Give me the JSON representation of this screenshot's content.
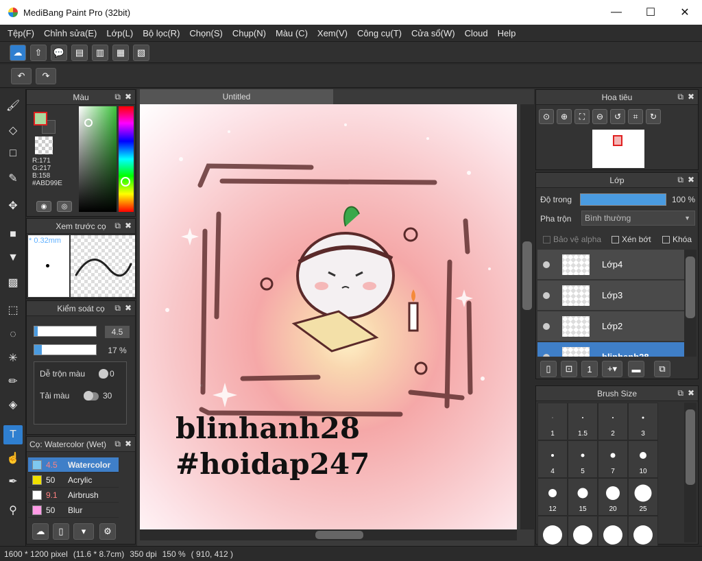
{
  "window": {
    "title": "MediBang Paint Pro (32bit)",
    "minimize": "—",
    "maximize": "☐",
    "close": "✕"
  },
  "menu": [
    "Tệp(F)",
    "Chỉnh sửa(E)",
    "Lớp(L)",
    "Bộ lọc(R)",
    "Chọn(S)",
    "Chụp(N)",
    "Màu (C)",
    "Xem(V)",
    "Công cụ(T)",
    "Cửa sổ(W)",
    "Cloud",
    "Help"
  ],
  "color_panel": {
    "title": "Màu",
    "r": "R:171",
    "g": "G:217",
    "b": "B:158",
    "hex": "#ABD99E",
    "current_color": "#ABD99E"
  },
  "brush_preview": {
    "title": "Xem trước cọ",
    "size": "* 0.32mm"
  },
  "brush_control": {
    "title": "Kiểm soát cọ",
    "size_value": "4.5",
    "size_fill": 0.05,
    "opacity_value": "17 %",
    "opacity_fill": 0.12,
    "blend_label": "Dễ trộn màu",
    "blend_value": "0",
    "load_label": "Tải màu",
    "load_value": "30"
  },
  "brush_list": {
    "title": "Cọ: Watercolor (Wet)",
    "items": [
      {
        "num": "4.5",
        "name": "Watercolor",
        "color": "#7ec8f0"
      },
      {
        "num": "50",
        "name": "Acrylic",
        "color": "#f0e000"
      },
      {
        "num": "9.1",
        "name": "Airbrush",
        "color": "#ffffff"
      },
      {
        "num": "50",
        "name": "Blur",
        "color": "#ff9be6"
      }
    ]
  },
  "document": {
    "tab": "Untitled",
    "text1": "blinhanh28",
    "text2": "#hoidap247"
  },
  "navigator": {
    "title": "Hoa tiêu"
  },
  "layers": {
    "title": "Lớp",
    "opacity_label": "Độ trong",
    "opacity_value": "100 %",
    "blend_label": "Pha trộn",
    "blend_value": "Bình thường",
    "protect_alpha": "Bảo vệ alpha",
    "clip": "Xén bớt",
    "lock": "Khóa",
    "items": [
      {
        "name": "Lớp4"
      },
      {
        "name": "Lớp3"
      },
      {
        "name": "Lớp2"
      },
      {
        "name": "blinhanh28"
      }
    ]
  },
  "brush_size": {
    "title": "Brush Size",
    "sizes": [
      "1",
      "1.5",
      "2",
      "3",
      "4",
      "5",
      "7",
      "10",
      "12",
      "15",
      "20",
      "25"
    ]
  },
  "status": {
    "dimensions": "1600 * 1200 pixel",
    "physical": "(11.6 * 8.7cm)",
    "dpi": "350 dpi",
    "zoom": "150 %",
    "coords": "( 910, 412 )"
  }
}
